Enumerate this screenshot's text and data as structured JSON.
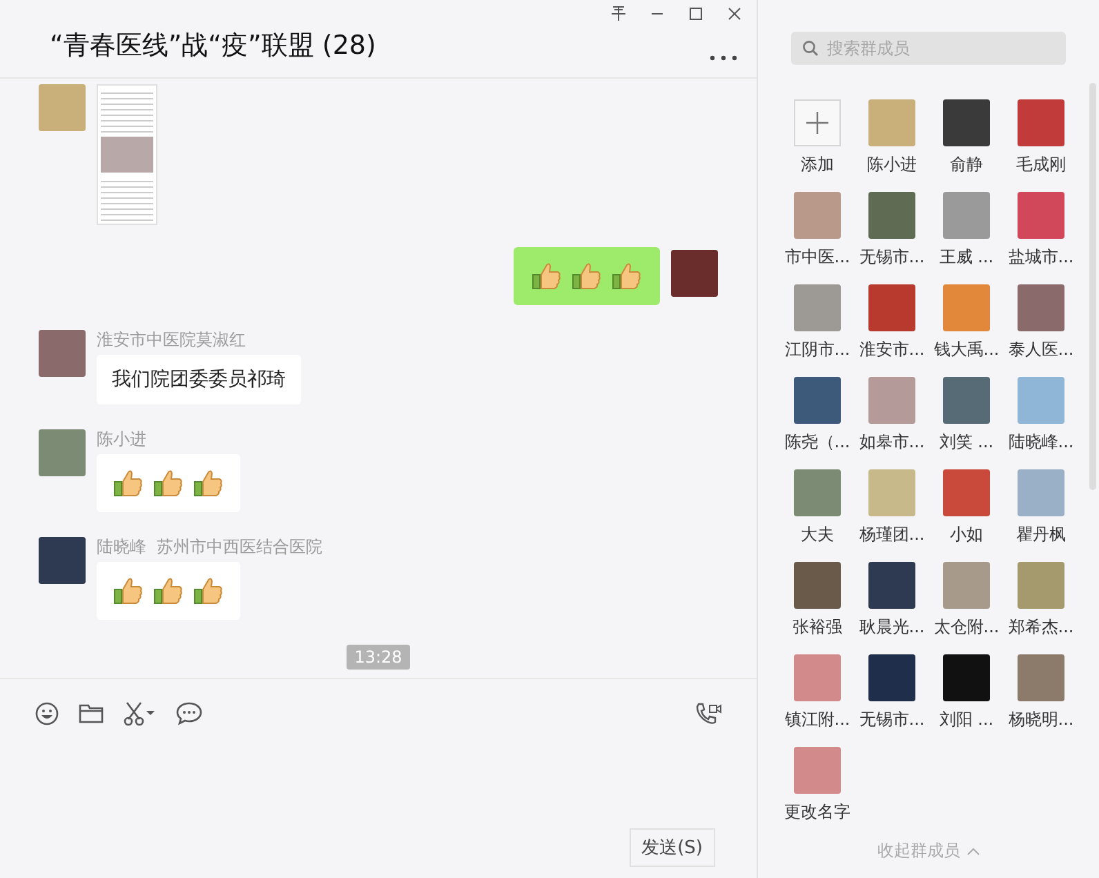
{
  "window": {
    "title": "“青春医线”战“疫”联盟 (28)"
  },
  "messages": [
    {
      "kind": "image",
      "outgoing": false
    },
    {
      "kind": "thumbs",
      "outgoing": true
    },
    {
      "kind": "text",
      "outgoing": false,
      "sender": "淮安市中医院莫淑红",
      "text": "我们院团委委员祁琦"
    },
    {
      "kind": "thumbs",
      "outgoing": false,
      "sender": "陈小进"
    },
    {
      "kind": "thumbs",
      "outgoing": false,
      "sender": "陆晓峰  苏州市中西医结合医院"
    },
    {
      "kind": "time",
      "text": "13:28"
    }
  ],
  "input": {
    "send_button": "发送(S)"
  },
  "members_panel": {
    "search": {
      "placeholder": "搜索群成员"
    },
    "members": [
      {
        "kind": "add",
        "name": "添加"
      },
      {
        "kind": "member",
        "name": "陈小进"
      },
      {
        "kind": "member",
        "name": "俞静"
      },
      {
        "kind": "member",
        "name": "毛成刚"
      },
      {
        "kind": "member",
        "name": "市中医..."
      },
      {
        "kind": "member",
        "name": "无锡市..."
      },
      {
        "kind": "member",
        "name": "王威 ..."
      },
      {
        "kind": "member",
        "name": "盐城市..."
      },
      {
        "kind": "member",
        "name": "江阴市..."
      },
      {
        "kind": "member",
        "name": "淮安市..."
      },
      {
        "kind": "member",
        "name": "钱大禹..."
      },
      {
        "kind": "member",
        "name": "泰人医..."
      },
      {
        "kind": "member",
        "name": "陈尧（..."
      },
      {
        "kind": "member",
        "name": "如皋市..."
      },
      {
        "kind": "member",
        "name": "刘笑 ..."
      },
      {
        "kind": "member",
        "name": "陆晓峰..."
      },
      {
        "kind": "member",
        "name": "大夫"
      },
      {
        "kind": "member",
        "name": "杨瑾团..."
      },
      {
        "kind": "member",
        "name": "小如"
      },
      {
        "kind": "member",
        "name": "瞿丹枫"
      },
      {
        "kind": "member",
        "name": "张裕强"
      },
      {
        "kind": "member",
        "name": "耿晨光..."
      },
      {
        "kind": "member",
        "name": "太仓附..."
      },
      {
        "kind": "member",
        "name": "郑希杰..."
      },
      {
        "kind": "member",
        "name": "镇江附..."
      },
      {
        "kind": "member",
        "name": "无锡市..."
      },
      {
        "kind": "member",
        "name": "刘阳 ..."
      },
      {
        "kind": "member",
        "name": "杨晓明..."
      },
      {
        "kind": "member",
        "name": "更改名字"
      }
    ],
    "collapse": "收起群成员"
  }
}
